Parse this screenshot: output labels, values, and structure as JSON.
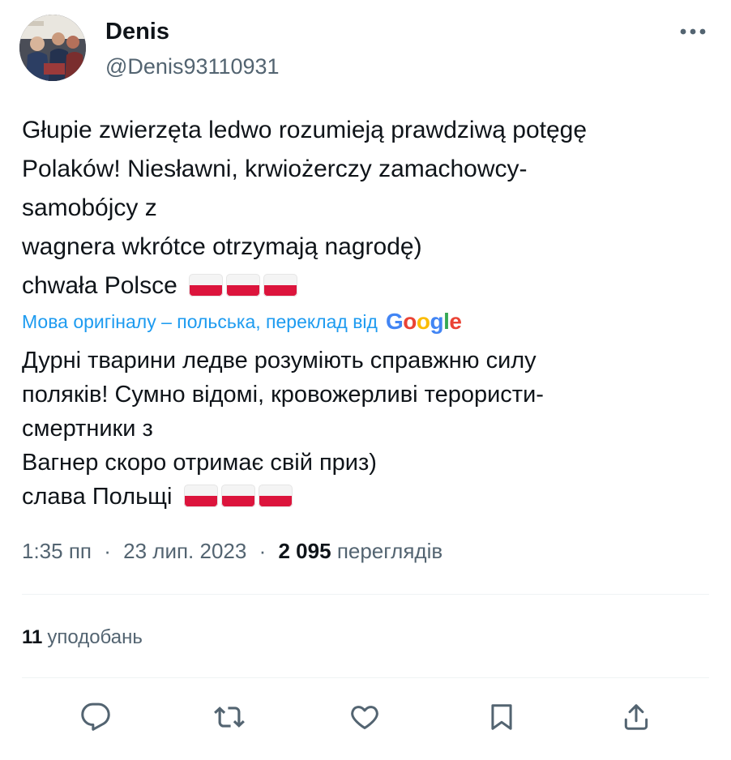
{
  "tweet": {
    "author": {
      "display_name": "Denis",
      "handle": "@Denis93110931"
    },
    "original_text": {
      "lines": [
        "Głupie zwierzęta ledwo rozumieją prawdziwą potęgę",
        "Polaków! Niesławni, krwiożerczy zamachowcy-",
        "samobójcy z",
        "wagnera wkrótce otrzymają nagrodę)",
        "chwała Polsce"
      ]
    },
    "translation": {
      "label": "Мова оригіналу – польська, переклад від",
      "provider": "Google",
      "lines": [
        "Дурні тварини ледве розуміють справжню силу",
        "поляків! Сумно відомі, кровожерливі терористи-",
        "смертники з",
        "Вагнер скоро отримає свій приз)",
        "слава Польщі"
      ]
    },
    "flag_emoji": "🇵🇱",
    "meta": {
      "time": "1:35 пп",
      "separator": "·",
      "date": "23 лип. 2023",
      "views_count": "2 095",
      "views_label": "переглядів"
    },
    "stats": {
      "likes_count": "11",
      "likes_label": "уподобань"
    },
    "icons": {
      "more": "more-horizontal-icon",
      "reply": "reply-icon",
      "retweet": "retweet-icon",
      "like": "heart-icon",
      "bookmark": "bookmark-icon",
      "share": "share-icon"
    },
    "colors": {
      "link": "#1d9bf0",
      "secondary_text": "#536471",
      "primary_text": "#0f1419",
      "flag_red": "#dc143c"
    }
  }
}
